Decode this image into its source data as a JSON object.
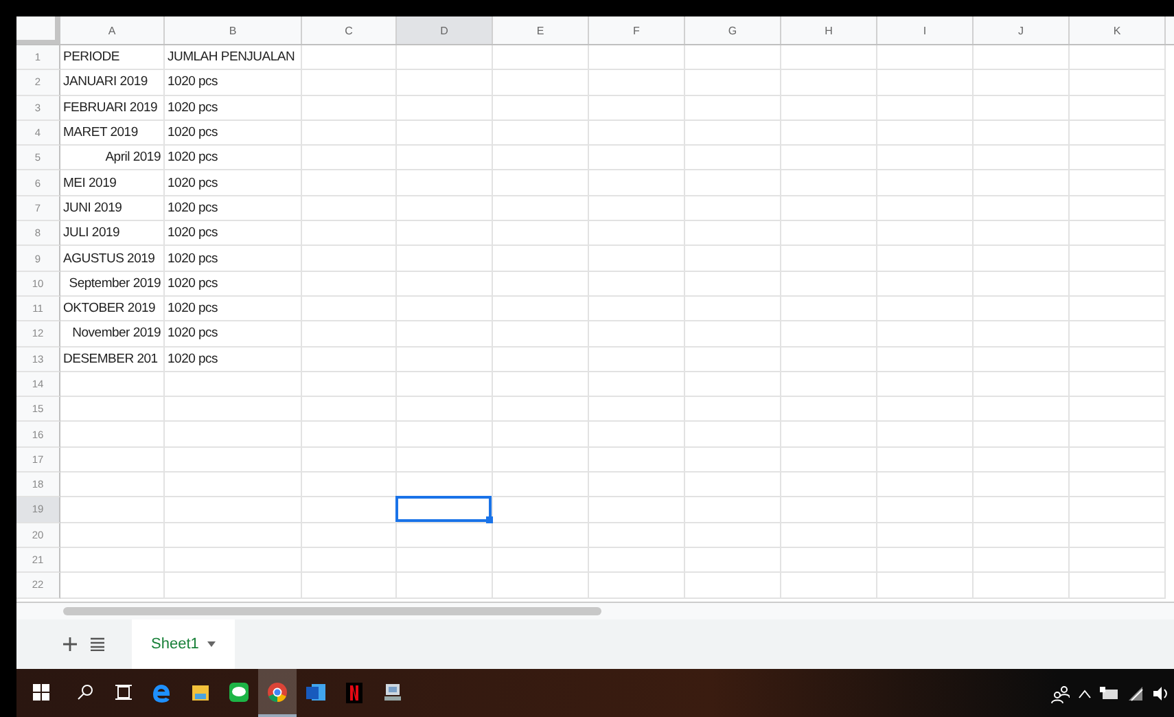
{
  "columns": [
    {
      "label": "A",
      "selected": false
    },
    {
      "label": "B",
      "selected": false
    },
    {
      "label": "C",
      "selected": false
    },
    {
      "label": "D",
      "selected": true
    },
    {
      "label": "E",
      "selected": false
    },
    {
      "label": "F",
      "selected": false
    },
    {
      "label": "G",
      "selected": false
    },
    {
      "label": "H",
      "selected": false
    },
    {
      "label": "I",
      "selected": false
    },
    {
      "label": "J",
      "selected": false
    },
    {
      "label": "K",
      "selected": false
    }
  ],
  "rows": [
    {
      "header": "1",
      "selected": false,
      "cells": [
        {
          "text": "PERIODE",
          "right_aligned": false
        },
        {
          "text": "JUMLAH PENJUALAN",
          "right_aligned": false
        }
      ]
    },
    {
      "header": "2",
      "selected": false,
      "cells": [
        {
          "text": "JANUARI 2019",
          "right_aligned": false
        },
        {
          "text": "1020 pcs",
          "right_aligned": false
        }
      ]
    },
    {
      "header": "3",
      "selected": false,
      "cells": [
        {
          "text": "FEBRUARI 2019",
          "right_aligned": false
        },
        {
          "text": "1020 pcs",
          "right_aligned": false
        }
      ]
    },
    {
      "header": "4",
      "selected": false,
      "cells": [
        {
          "text": "MARET 2019",
          "right_aligned": false
        },
        {
          "text": "1020 pcs",
          "right_aligned": false
        }
      ]
    },
    {
      "header": "5",
      "selected": false,
      "cells": [
        {
          "text": "April 2019",
          "right_aligned": true
        },
        {
          "text": "1020 pcs",
          "right_aligned": false
        }
      ]
    },
    {
      "header": "6",
      "selected": false,
      "cells": [
        {
          "text": "MEI 2019",
          "right_aligned": false
        },
        {
          "text": "1020 pcs",
          "right_aligned": false
        }
      ]
    },
    {
      "header": "7",
      "selected": false,
      "cells": [
        {
          "text": "JUNI 2019",
          "right_aligned": false
        },
        {
          "text": "1020 pcs",
          "right_aligned": false
        }
      ]
    },
    {
      "header": "8",
      "selected": false,
      "cells": [
        {
          "text": "JULI 2019",
          "right_aligned": false
        },
        {
          "text": "1020 pcs",
          "right_aligned": false
        }
      ]
    },
    {
      "header": "9",
      "selected": false,
      "cells": [
        {
          "text": "AGUSTUS 2019",
          "right_aligned": false
        },
        {
          "text": "1020 pcs",
          "right_aligned": false
        }
      ]
    },
    {
      "header": "10",
      "selected": false,
      "cells": [
        {
          "text": "September 2019",
          "right_aligned": true
        },
        {
          "text": "1020 pcs",
          "right_aligned": false
        }
      ]
    },
    {
      "header": "11",
      "selected": false,
      "cells": [
        {
          "text": "OKTOBER 2019",
          "right_aligned": false
        },
        {
          "text": "1020 pcs",
          "right_aligned": false
        }
      ]
    },
    {
      "header": "12",
      "selected": false,
      "cells": [
        {
          "text": "November 2019",
          "right_aligned": true
        },
        {
          "text": "1020 pcs",
          "right_aligned": false
        }
      ]
    },
    {
      "header": "13",
      "selected": false,
      "cells": [
        {
          "text": "DESEMBER 201",
          "right_aligned": false
        },
        {
          "text": "1020 pcs",
          "right_aligned": false
        }
      ]
    },
    {
      "header": "14",
      "selected": false
    },
    {
      "header": "15",
      "selected": false
    },
    {
      "header": "16",
      "selected": false
    },
    {
      "header": "17",
      "selected": false
    },
    {
      "header": "18",
      "selected": false
    },
    {
      "header": "19",
      "selected": true
    },
    {
      "header": "20",
      "selected": false
    },
    {
      "header": "21",
      "selected": false
    },
    {
      "header": "22",
      "selected": false
    }
  ],
  "sheet_tabs": [
    {
      "label": "Sheet1",
      "selected": true
    }
  ],
  "taskbar": {
    "apps": [
      {
        "kind": "edge",
        "active": false
      },
      {
        "kind": "files",
        "active": false
      },
      {
        "kind": "chat",
        "active": false
      },
      {
        "kind": "chrome",
        "active": true
      },
      {
        "kind": "word",
        "active": false
      },
      {
        "kind": "netflix",
        "active": false
      },
      {
        "kind": "tool",
        "active": false
      }
    ]
  }
}
